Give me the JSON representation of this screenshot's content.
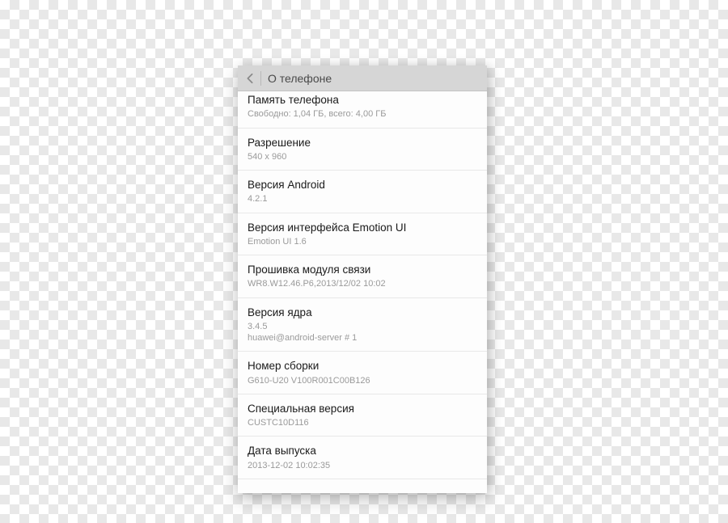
{
  "header": {
    "title": "О телефоне"
  },
  "items": [
    {
      "title": "Память телефона",
      "value": "Свободно: 1,04 ГБ, всего: 4,00 ГБ"
    },
    {
      "title": "Разрешение",
      "value": "540 x 960"
    },
    {
      "title": "Версия Android",
      "value": "4.2.1"
    },
    {
      "title": "Версия интерфейса Emotion UI",
      "value": "Emotion UI 1.6"
    },
    {
      "title": "Прошивка модуля связи",
      "value": "WR8.W12.46.P6,2013/12/02 10:02"
    },
    {
      "title": "Версия ядра",
      "value": "3.4.5",
      "value2": "huawei@android-server # 1"
    },
    {
      "title": "Номер сборки",
      "value": "G610-U20 V100R001C00B126"
    },
    {
      "title": "Специальная версия",
      "value": "CUSTC10D116"
    },
    {
      "title": "Дата выпуска",
      "value": "2013-12-02 10:02:35"
    }
  ]
}
